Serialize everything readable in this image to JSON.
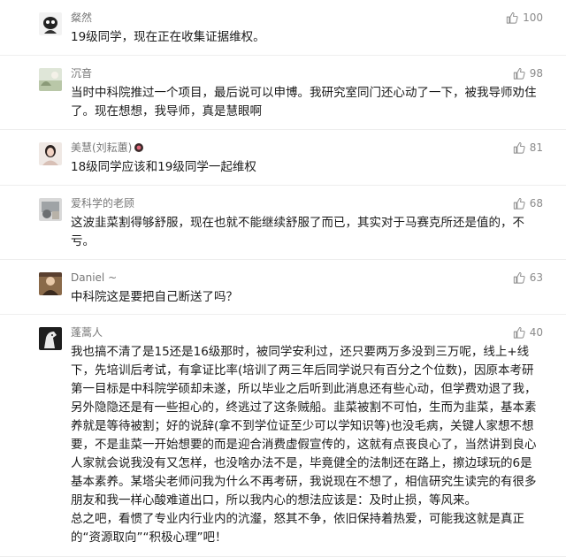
{
  "comments": [
    {
      "username": "粲然",
      "likes": "100",
      "lines": [
        "19级同学，现在正在收集证据维权。"
      ],
      "avatar_icon": "person-avatar-icon"
    },
    {
      "username": "沉音",
      "likes": "98",
      "lines": [
        "当时中科院推过一个项目，最后说可以申博。我研究室同门还心动了一下，被我导师劝住了。现在想想，我导师，真是慧眼啊"
      ],
      "avatar_icon": "landscape-avatar-icon"
    },
    {
      "username": "美慧(刘耘蕙)",
      "likes": "81",
      "lines": [
        "18级同学应该和19级同学一起维权"
      ],
      "avatar_icon": "portrait-avatar-icon"
    },
    {
      "username": "爱科学的老顾",
      "likes": "68",
      "lines": [
        "这波韭菜割得够舒服，现在也就不能继续舒服了而已，其实对于马赛克所还是值的，不亏。"
      ],
      "avatar_icon": "photo-avatar-icon"
    },
    {
      "username": "Daniel ~",
      "likes": "63",
      "lines": [
        "中科院这是要把自己断送了吗？"
      ],
      "avatar_icon": "person-photo-avatar-icon"
    },
    {
      "username": "蓬蒿人",
      "likes": "40",
      "lines": [
        "我也搞不清了是15还是16级那时，被同学安利过，还只要两万多没到三万呢，线上+线下，先培训后考试，有拿证比率(培训了两三年后同学说只有百分之个位数)，因原本考研第一目标是中科院学硕却未遂，所以毕业之后听到此消息还有些心动，但学费劝退了我，另外隐隐还是有一些担心的，终逃过了这条贼船。韭菜被割不可怕，生而为韭菜，基本素养就是等待被割；好的说辞(拿不到学位证至少可以学知识等)也没毛病，关键人家想不想要，不是韭菜一开始想要的而是迎合消费虚假宣传的，这就有点丧良心了，当然讲到良心人家就会说我没有又怎样，也没啥办法不是，毕竟健全的法制还在路上，擦边球玩的6是基本素养。某塔尖老师问我为什么不再考研，我说现在不想了，相信研究生读完的有很多朋友和我一样心酸难道出口，所以我内心的想法应该是：及时止损，等风来。",
        "总之吧，看惯了专业内行业内的沆瀣，怒其不争，依旧保持着热爱，可能我这就是真正的“资源取向”“积极心理”吧！"
      ],
      "avatar_icon": "horse-avatar-icon"
    }
  ],
  "like_icon": "thumbs-up-icon",
  "colors": {
    "username": "#777777",
    "likes": "#8a8a8a",
    "text": "#1a1a1a",
    "divider": "#eeeeee"
  }
}
